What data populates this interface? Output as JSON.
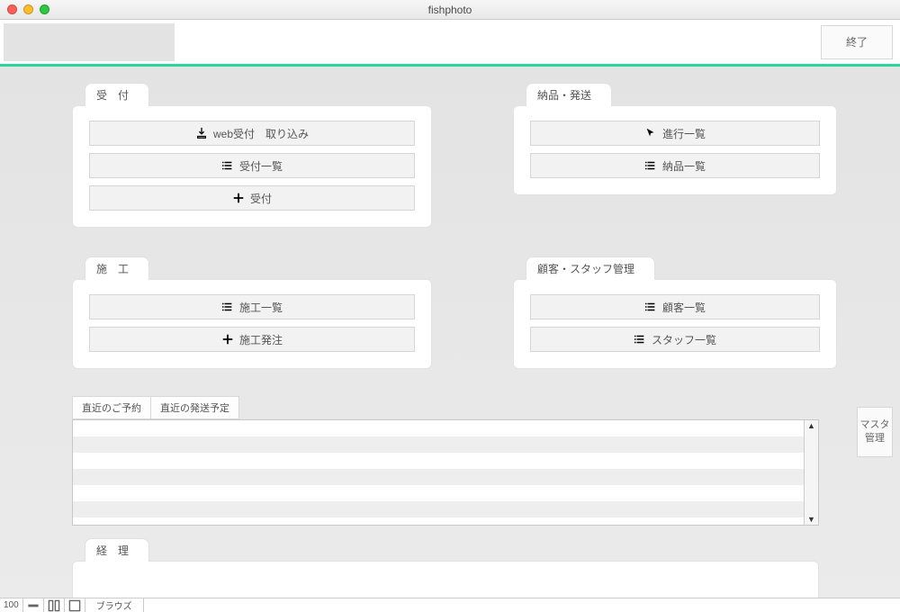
{
  "window": {
    "title": "fishphoto"
  },
  "header": {
    "exit_label": "終了"
  },
  "panels": {
    "reception": {
      "title": "受　付",
      "buttons": {
        "web_import": "web受付　取り込み",
        "reception_list": "受付一覧",
        "reception_new": "受付"
      }
    },
    "delivery": {
      "title": "納品・発送",
      "buttons": {
        "progress_list": "進行一覧",
        "delivery_list": "納品一覧"
      }
    },
    "construction": {
      "title": "施　工",
      "buttons": {
        "construction_list": "施工一覧",
        "construction_order": "施工発注"
      }
    },
    "customer_staff": {
      "title": "顧客・スタッフ管理",
      "buttons": {
        "customer_list": "顧客一覧",
        "staff_list": "スタッフ一覧"
      }
    },
    "accounting": {
      "title": "経　理"
    }
  },
  "master_button": "マスタ\n管理",
  "lower_tabs": {
    "tab1": "直近のご予約",
    "tab2": "直近の発送予定"
  },
  "scroll": {
    "up": "▲",
    "down": "▼"
  },
  "statusbar": {
    "zoom": "100",
    "mode": "ブラウズ"
  }
}
